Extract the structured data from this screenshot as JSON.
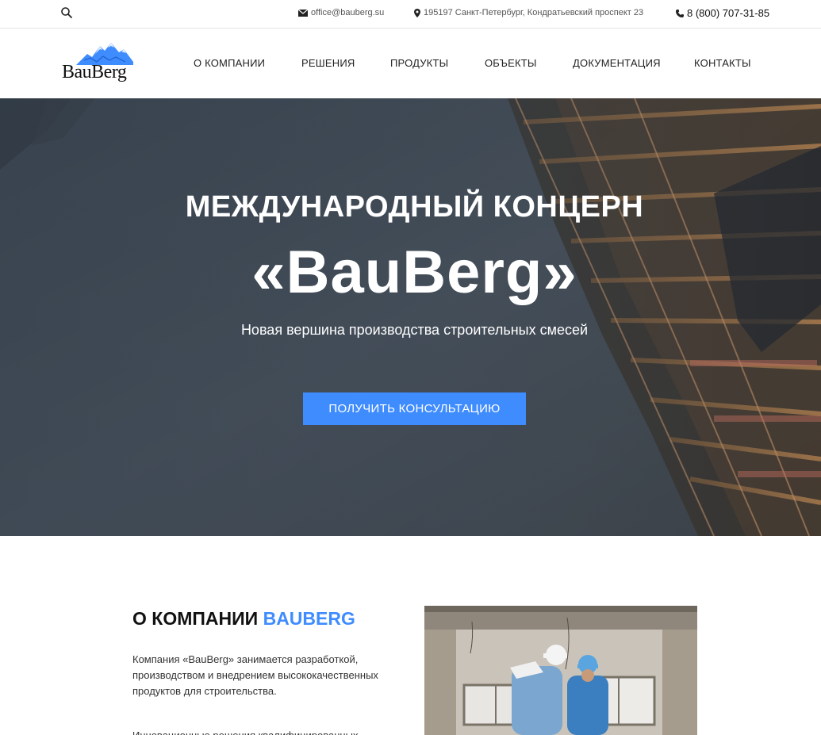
{
  "topbar": {
    "email": "office@bauberg.su",
    "address": "195197 Санкт-Петербург, Кондратьевский проспект 23",
    "phone": "8 (800) 707-31-85"
  },
  "logo": {
    "text": "BauBerg"
  },
  "nav": {
    "items": [
      {
        "label": "О КОМПАНИИ"
      },
      {
        "label": "РЕШЕНИЯ"
      },
      {
        "label": "ПРОДУКТЫ"
      },
      {
        "label": "ОБЪЕКТЫ"
      },
      {
        "label": "ДОКУМЕНТАЦИЯ"
      },
      {
        "label": "КОНТАКТЫ"
      }
    ]
  },
  "hero": {
    "title": "МЕЖДУНАРОДНЫЙ КОНЦЕРН",
    "brand": "«BauBerg»",
    "subtitle": "Новая вершина производства строительных смесей",
    "cta_label": "ПОЛУЧИТЬ КОНСУЛЬТАЦИЮ"
  },
  "about": {
    "title_prefix": "О КОМПАНИИ",
    "title_accent": "BAUBERG",
    "paragraph1": "Компания «BauBerg» занимается разработкой, производством и внедрением высококачественных продуктов для строительства.",
    "paragraph2": "Инновационные решения квалифицированных"
  },
  "colors": {
    "accent": "#3f8cff",
    "hero_tint": "#46505a"
  },
  "icons": [
    "search-icon",
    "mail-icon",
    "location-pin-icon",
    "phone-icon",
    "mountain-logo-icon"
  ]
}
